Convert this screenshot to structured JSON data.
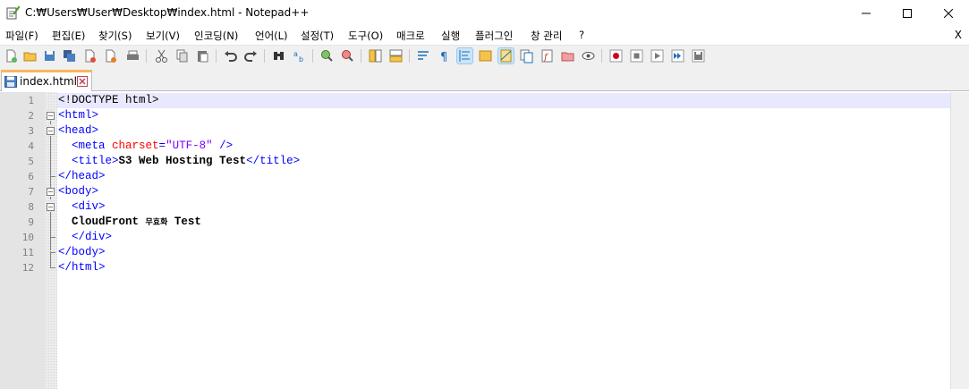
{
  "window": {
    "title": "C:₩Users₩User₩Desktop₩index.html - Notepad++",
    "controls": [
      "minimize-icon",
      "maximize-icon",
      "close-icon"
    ]
  },
  "menu": {
    "items": [
      "파일(F)",
      "편집(E)",
      "찾기(S)",
      "보기(V)",
      "인코딩(N)",
      "언어(L)",
      "설정(T)",
      "도구(O)",
      "매크로",
      "실행",
      "플러그인",
      "창 관리",
      "?"
    ],
    "close_label": "X"
  },
  "toolbar": {
    "icons": [
      "new-file-icon",
      "open-file-icon",
      "save-icon",
      "save-all-icon",
      "close-icon",
      "close-all-icon",
      "print-icon",
      "cut-icon",
      "copy-icon",
      "paste-icon",
      "undo-icon",
      "redo-icon",
      "find-icon",
      "replace-icon",
      "zoom-in-icon",
      "zoom-out-icon",
      "sync-vertical-icon",
      "sync-horizontal-icon",
      "word-wrap-icon",
      "show-all-chars-icon",
      "indent-guide-icon",
      "user-lang-icon",
      "doc-map-icon",
      "doc-list-icon",
      "function-list-icon",
      "folder-workspace-icon",
      "monitoring-icon",
      "record-macro-icon",
      "stop-macro-icon",
      "play-macro-icon",
      "run-macro-multiple-icon",
      "save-macro-icon"
    ]
  },
  "tab": {
    "label": "index.html"
  },
  "editor": {
    "line_numbers": [
      "1",
      "2",
      "3",
      "4",
      "5",
      "6",
      "7",
      "8",
      "9",
      "10",
      "11",
      "12"
    ],
    "lines": [
      {
        "doctype": "<!DOCTYPE html>"
      },
      {
        "tag": "<html>"
      },
      {
        "tag": "<head>"
      },
      {
        "tag_open": "<meta ",
        "attr": "charset",
        "eq": "=",
        "value": "\"UTF-8\"",
        "tag_close": " />"
      },
      {
        "tag_open": "<title>",
        "text": "S3 Web Hosting Test",
        "tag_close": "</title>"
      },
      {
        "tag": "</head>"
      },
      {
        "tag": "<body>"
      },
      {
        "tag": "<div>"
      },
      {
        "text_a": "CloudFront ",
        "text_small": "무효화",
        "text_b": " Test"
      },
      {
        "tag": "</div>"
      },
      {
        "tag": "</body>"
      },
      {
        "tag": "</html>"
      }
    ]
  },
  "colors": {
    "tag": "#0000ff",
    "attribute": "#ff0000",
    "string": "#8000ff",
    "current_line": "#e8e8ff",
    "tab_accent": "#fab65f"
  }
}
